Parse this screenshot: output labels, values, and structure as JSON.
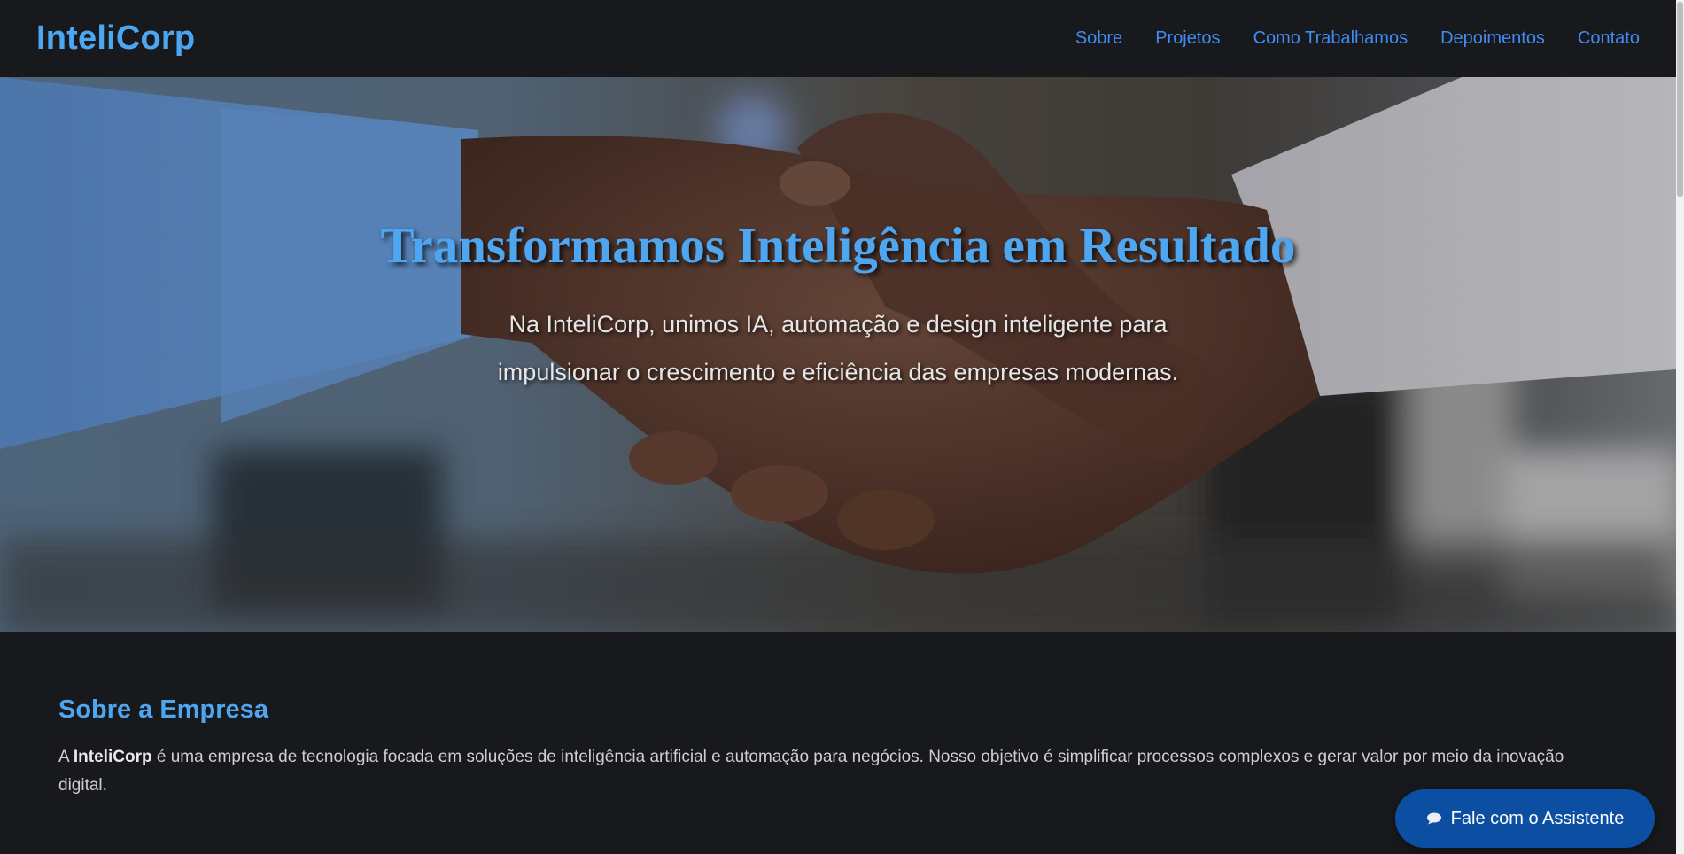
{
  "brand": "InteliCorp",
  "nav": {
    "items": [
      {
        "label": "Sobre"
      },
      {
        "label": "Projetos"
      },
      {
        "label": "Como Trabalhamos"
      },
      {
        "label": "Depoimentos"
      },
      {
        "label": "Contato"
      }
    ]
  },
  "hero": {
    "title": "Transformamos Inteligência em Resultado",
    "subtitle_line1": "Na InteliCorp, unimos IA, automação e design inteligente para",
    "subtitle_line2": "impulsionar o crescimento e eficiência das empresas modernas.",
    "image": "handshake-photo"
  },
  "about": {
    "title": "Sobre a Empresa",
    "text_prefix": "A ",
    "text_bold": "InteliCorp",
    "text_rest": " é uma empresa de tecnologia focada em soluções de inteligência artificial e automação para negócios. Nosso objetivo é simplificar processos complexos e gerar valor por meio da inovação digital."
  },
  "assistant_button": {
    "label": "Fale com o Assistente",
    "icon": "chat-bubble-icon"
  },
  "colors": {
    "background": "#17191c",
    "brand": "#4da7f0",
    "nav_link": "#3f8cf2",
    "button": "#0b4ea2"
  }
}
